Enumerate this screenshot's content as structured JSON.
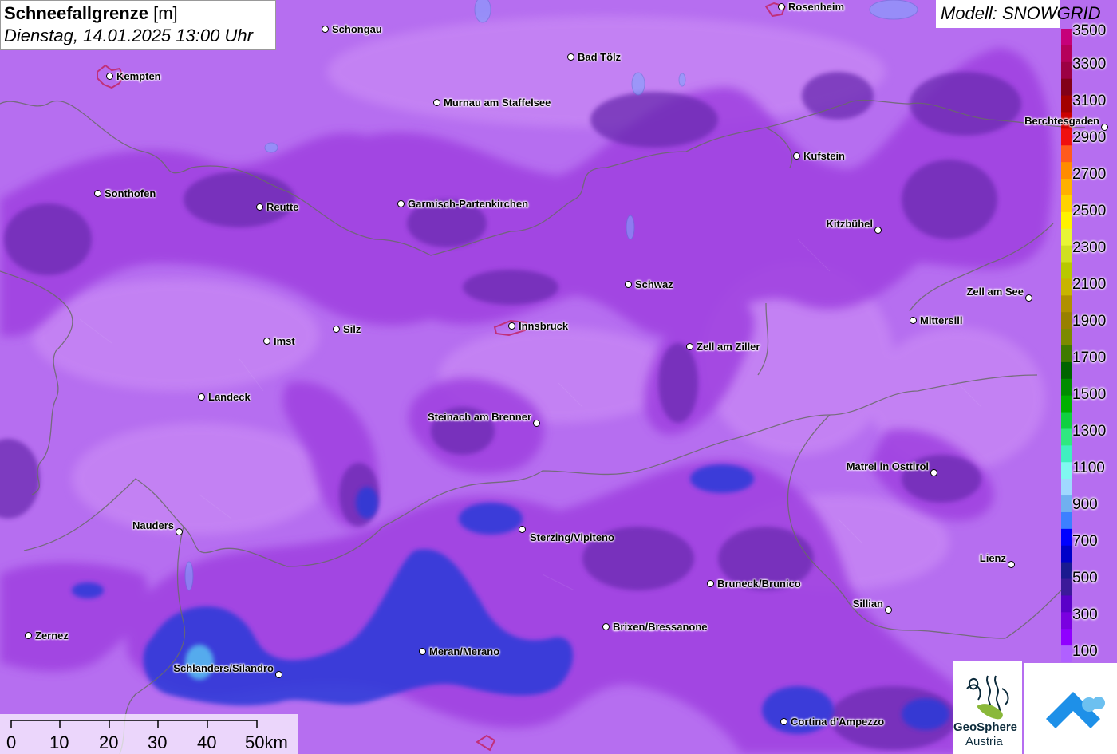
{
  "title": {
    "parameter": "Schneefallgrenze",
    "unit": "[m]",
    "datetime": "Dienstag, 14.01.2025 13:00 Uhr"
  },
  "model_label": "Modell: SNOWGRID",
  "legend": {
    "labels": [
      "3500",
      "3300",
      "3100",
      "2900",
      "2700",
      "2500",
      "2300",
      "2100",
      "1900",
      "1700",
      "1500",
      "1300",
      "1100",
      "900",
      "700",
      "500",
      "300",
      "100"
    ],
    "colors": [
      "#c6007a",
      "#b5005a",
      "#9c0044",
      "#820018",
      "#a30000",
      "#cc0000",
      "#f01010",
      "#ff5a1e",
      "#ff8c00",
      "#ffb000",
      "#ffd200",
      "#fff200",
      "#e8f535",
      "#d0e020",
      "#b8c800",
      "#c8b400",
      "#b09000",
      "#988000",
      "#7c8a00",
      "#3f7a00",
      "#006400",
      "#008c00",
      "#00b000",
      "#10d040",
      "#30e880",
      "#40f0c0",
      "#80f8f0",
      "#a0d8ff",
      "#70b0f0",
      "#3c80ff",
      "#0000ff",
      "#0000c8",
      "#1a1a90",
      "#3c1a9a",
      "#5a00c8",
      "#7a00e0",
      "#9000ff",
      "#b060ff"
    ]
  },
  "cities": [
    {
      "name": "Rosenheim"
    },
    {
      "name": "Schongau"
    },
    {
      "name": "Kempten"
    },
    {
      "name": "Bad Tölz"
    },
    {
      "name": "Murnau am Staffelsee"
    },
    {
      "name": "Berchtesgaden"
    },
    {
      "name": "Kufstein"
    },
    {
      "name": "Sonthofen"
    },
    {
      "name": "Reutte"
    },
    {
      "name": "Garmisch-Partenkirchen"
    },
    {
      "name": "Kitzbühel"
    },
    {
      "name": "Schwaz"
    },
    {
      "name": "Zell am See"
    },
    {
      "name": "Mittersill"
    },
    {
      "name": "Innsbruck"
    },
    {
      "name": "Imst"
    },
    {
      "name": "Silz"
    },
    {
      "name": "Zell am Ziller"
    },
    {
      "name": "Landeck"
    },
    {
      "name": "Steinach am Brenner"
    },
    {
      "name": "Matrei in Osttirol"
    },
    {
      "name": "Nauders"
    },
    {
      "name": "Sterzing/Vipiteno"
    },
    {
      "name": "Lienz"
    },
    {
      "name": "Bruneck/Brunico"
    },
    {
      "name": "Sillian"
    },
    {
      "name": "Brixen/Bressanone"
    },
    {
      "name": "Zernez"
    },
    {
      "name": "Meran/Merano"
    },
    {
      "name": "Schlanders/Silandro"
    },
    {
      "name": "Cortina d'Ampezzo"
    }
  ],
  "scale": {
    "labels": [
      "0",
      "10",
      "20",
      "30",
      "40",
      "50km"
    ]
  },
  "logos": {
    "geosphere_line1": "GeoSphere",
    "geosphere_line2": "Austria"
  }
}
